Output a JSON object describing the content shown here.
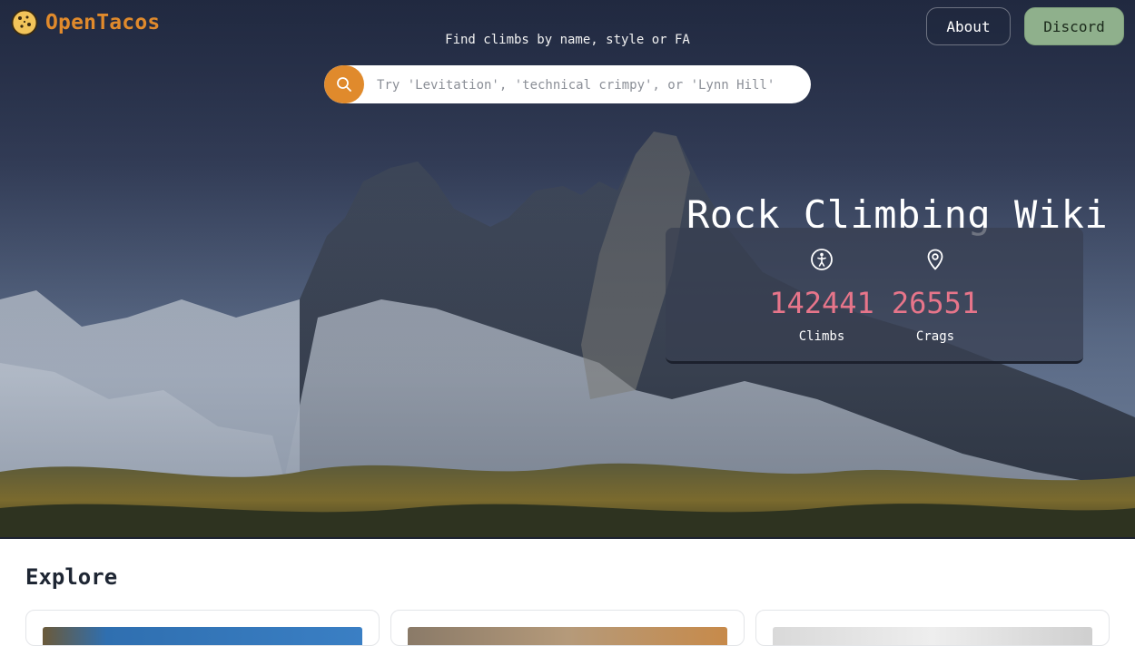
{
  "header": {
    "logo_text": "OpenTacos",
    "about_label": "About",
    "discord_label": "Discord"
  },
  "search": {
    "caption": "Find climbs by name, style or FA",
    "placeholder": "Try 'Levitation', 'technical crimpy', or 'Lynn Hill'"
  },
  "hero": {
    "title": "Rock Climbing Wiki",
    "stats": [
      {
        "icon": "climber-icon",
        "value": "142441",
        "label": "Climbs"
      },
      {
        "icon": "location-pin-icon",
        "value": "26551",
        "label": "Crags"
      }
    ]
  },
  "explore": {
    "heading": "Explore",
    "cards": [
      {
        "image": "card-image"
      },
      {
        "image": "card-image"
      },
      {
        "image": "card-image"
      }
    ]
  },
  "colors": {
    "brand_orange": "#e08a2c",
    "discord_green": "#8fb08c",
    "stat_pink": "#e7758a"
  }
}
